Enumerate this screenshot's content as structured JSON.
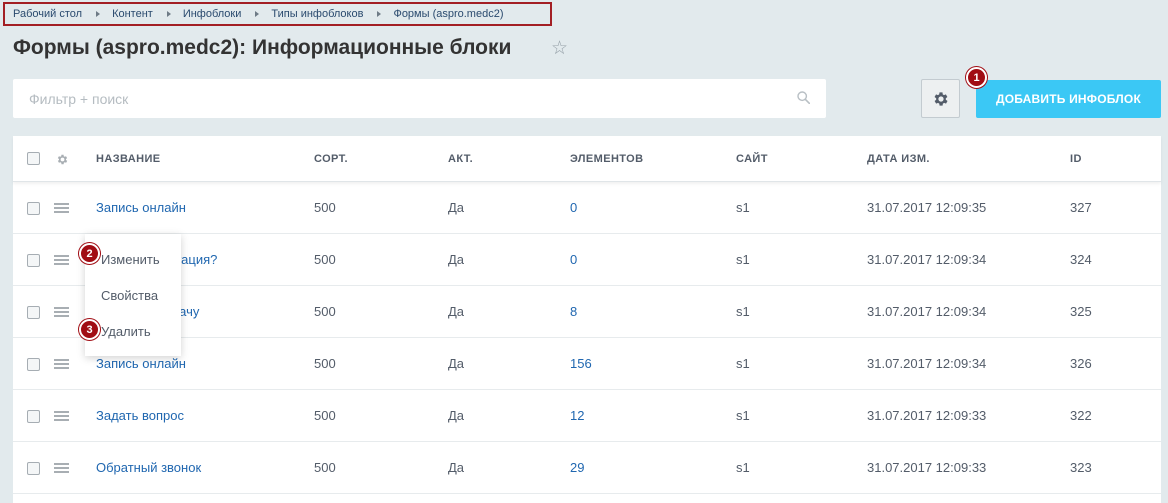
{
  "breadcrumb": [
    "Рабочий стол",
    "Контент",
    "Инфоблоки",
    "Типы инфоблоков",
    "Формы (aspro.medc2)"
  ],
  "page_title": "Формы (aspro.medc2): Информационные блоки",
  "filter": {
    "placeholder": "Фильтр + поиск"
  },
  "toolbar": {
    "add_label": "ДОБАВИТЬ ИНФОБЛОК"
  },
  "badges": {
    "b1": "1",
    "b2": "2",
    "b3": "3"
  },
  "columns": {
    "name": "НАЗВАНИЕ",
    "sort": "СОРТ.",
    "active": "АКТ.",
    "elements": "ЭЛЕМЕНТОВ",
    "site": "САЙТ",
    "date": "ДАТА ИЗМ.",
    "id": "ID"
  },
  "rows": [
    {
      "name": "Запись онлайн",
      "sort": "500",
      "active": "Да",
      "elements": "0",
      "site": "s1",
      "date": "31.07.2017 12:09:35",
      "id": "327"
    },
    {
      "name": "льтация?",
      "sort": "500",
      "active": "Да",
      "elements": "0",
      "site": "s1",
      "date": "31.07.2017 12:09:34",
      "id": "324"
    },
    {
      "name": "врачу",
      "sort": "500",
      "active": "Да",
      "elements": "8",
      "site": "s1",
      "date": "31.07.2017 12:09:34",
      "id": "325"
    },
    {
      "name": "Запись онлайн",
      "sort": "500",
      "active": "Да",
      "elements": "156",
      "site": "s1",
      "date": "31.07.2017 12:09:34",
      "id": "326"
    },
    {
      "name": "Задать вопрос",
      "sort": "500",
      "active": "Да",
      "elements": "12",
      "site": "s1",
      "date": "31.07.2017 12:09:33",
      "id": "322"
    },
    {
      "name": "Обратный звонок",
      "sort": "500",
      "active": "Да",
      "elements": "29",
      "site": "s1",
      "date": "31.07.2017 12:09:33",
      "id": "323"
    }
  ],
  "context_menu": {
    "edit": "Изменить",
    "properties": "Свойства",
    "delete": "Удалить"
  },
  "colors": {
    "accent": "#3bc8f5",
    "badge": "#a10d14",
    "link": "#2067b0",
    "background": "#e2eaed"
  }
}
